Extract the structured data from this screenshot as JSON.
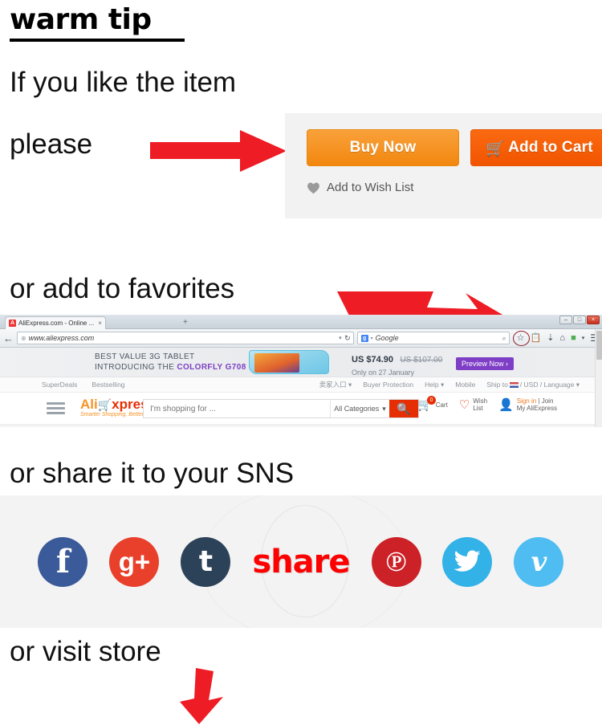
{
  "headline": "warm tip",
  "lines": {
    "if_you_like": "If you like the item",
    "please": "please",
    "or_add_favorites": "or add to favorites",
    "or_share_sns": "or share it to your SNS",
    "or_visit_store": "or visit store"
  },
  "buy_panel": {
    "buy_now_label": "Buy Now",
    "add_to_cart_label": "Add to Cart",
    "cart_icon": "shopping-cart-icon",
    "wish_list_label": "Add to Wish List",
    "heart_icon": "heart-icon",
    "buy_now_color": "#f2870f",
    "add_to_cart_color": "#f25400",
    "panel_bg": "#f2f2f2"
  },
  "browser": {
    "tab_title": "AliExpress.com - Online ...",
    "tab_favicon": "aliexpress-favicon",
    "tab_close": "×",
    "new_tab": "+",
    "window_controls": [
      "–",
      "□",
      "×"
    ],
    "back_arrow": "←",
    "url_globe": "⊕",
    "url": "www.aliexpress.com",
    "url_dropdown": "▾",
    "reload": "↻",
    "search_engine_badge": "g",
    "search_engine_chevron": "▾",
    "search_engine": "Google",
    "search_magnifier": "⌕",
    "toolbar_icons": [
      "star-icon",
      "clipboard-icon",
      "download-icon",
      "home-icon",
      "addon-icon",
      "chevron-down-icon"
    ],
    "menu_icon": "hamburger-menu-icon",
    "star_highlight_color": "#8e1f2b"
  },
  "promo": {
    "line1": "BEST VALUE 3G TABLET",
    "line2_prefix": "INTRODUCING THE ",
    "line2_brand": "COLORFLY G708",
    "price_now": "US $74.90",
    "price_old": "US $107.00",
    "price_sub": "Only on 27 January",
    "cta": "Preview Now ›",
    "cta_color": "#7e3ec6"
  },
  "site_toprow": {
    "left": [
      "SuperDeals",
      "Bestselling"
    ],
    "right": [
      "卖家入口 ▾",
      "Buyer Protection",
      "Help ▾",
      "Mobile"
    ],
    "ship_to_label": "Ship to",
    "ship_to_suffix": "/ USD / Language ▾"
  },
  "site_header": {
    "menu_icon": "hamburger-menu-icon",
    "logo_ali": "Ali",
    "logo_cart_icon": "logo-cart-icon",
    "logo_xpress": "xpress",
    "logo_tagline": "Smarter Shopping, Better Living!",
    "search_placeholder": "I'm shopping for ...",
    "category_label": "All Categories",
    "category_chevron": "▾",
    "search_icon": "search-icon",
    "cart_icon": "cart-icon",
    "cart_label": "Cart",
    "cart_count": "0",
    "wish_icon": "heart-outline-icon",
    "wish_line1": "Wish",
    "wish_line2": "List",
    "account_icon": "user-icon",
    "sign_in": "Sign in",
    "sign_divider": " | Join",
    "my_aliexpress": "My AliExpress",
    "accent_color": "#e62e04"
  },
  "share": {
    "word": "share",
    "word_color": "#fd0000",
    "icons": [
      {
        "name": "facebook-icon",
        "glyph": "f",
        "color": "#3b5a9a",
        "cls": "s-f"
      },
      {
        "name": "google-plus-icon",
        "glyph": "g+",
        "color": "#e8402a",
        "cls": "s-g"
      },
      {
        "name": "tumblr-icon",
        "glyph": "t",
        "color": "#2c4259",
        "cls": "s-t"
      },
      {
        "name": "pinterest-icon",
        "glyph": "℗",
        "color": "#cc2127",
        "cls": "s-p"
      },
      {
        "name": "twitter-icon",
        "glyph": "ᴠ",
        "color": "#33b2e8",
        "cls": "s-tw"
      },
      {
        "name": "vimeo-icon",
        "glyph": "v",
        "color": "#4fbdf2",
        "cls": "s-v"
      }
    ]
  },
  "arrows": {
    "color": "#ee1c24",
    "right_arrow": "arrow-right-icon",
    "diagonal_arrow": "arrow-diagonal-down-right-icon",
    "down_arrow": "arrow-down-icon"
  }
}
